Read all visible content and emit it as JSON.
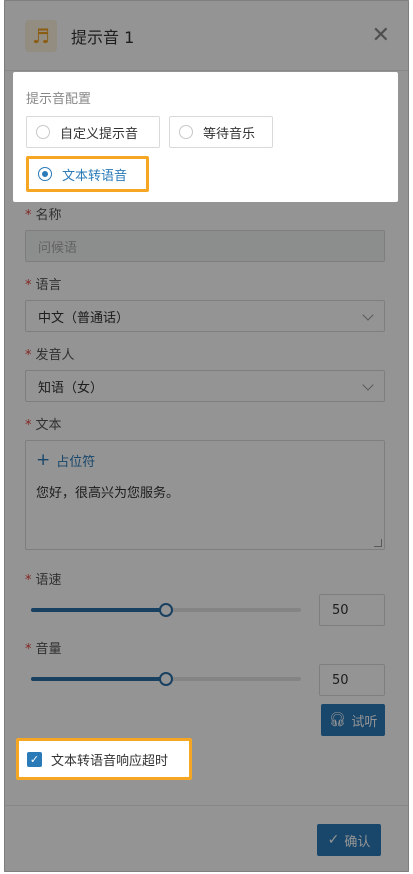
{
  "header": {
    "title": "提示音 1",
    "icon": "music-note-icon",
    "close_icon": "close-icon"
  },
  "form": {
    "name": {
      "label": "名称",
      "value": "问候语"
    },
    "language": {
      "label": "语言",
      "value": "中文（普通话）"
    },
    "voice": {
      "label": "发音人",
      "value": "知语（女）"
    },
    "text": {
      "label": "文本",
      "placeholder_button": "占位符",
      "value": "您好，很高兴为您服务。"
    },
    "speed": {
      "label": "语速",
      "value": "50",
      "fraction": 0.5
    },
    "volume": {
      "label": "音量",
      "value": "50",
      "fraction": 0.5
    },
    "listen_button": "试听",
    "timeout_checkbox": {
      "label": "文本转语音响应超时",
      "checked": true
    }
  },
  "footer": {
    "confirm_button": "确认"
  },
  "popup": {
    "label": "提示音配置",
    "options": [
      "自定义提示音",
      "等待音乐",
      "文本转语音"
    ],
    "selected": "文本转语音"
  },
  "colors": {
    "accent": "#2a7ab8",
    "highlight": "#f5a623",
    "required": "#e0413a"
  }
}
